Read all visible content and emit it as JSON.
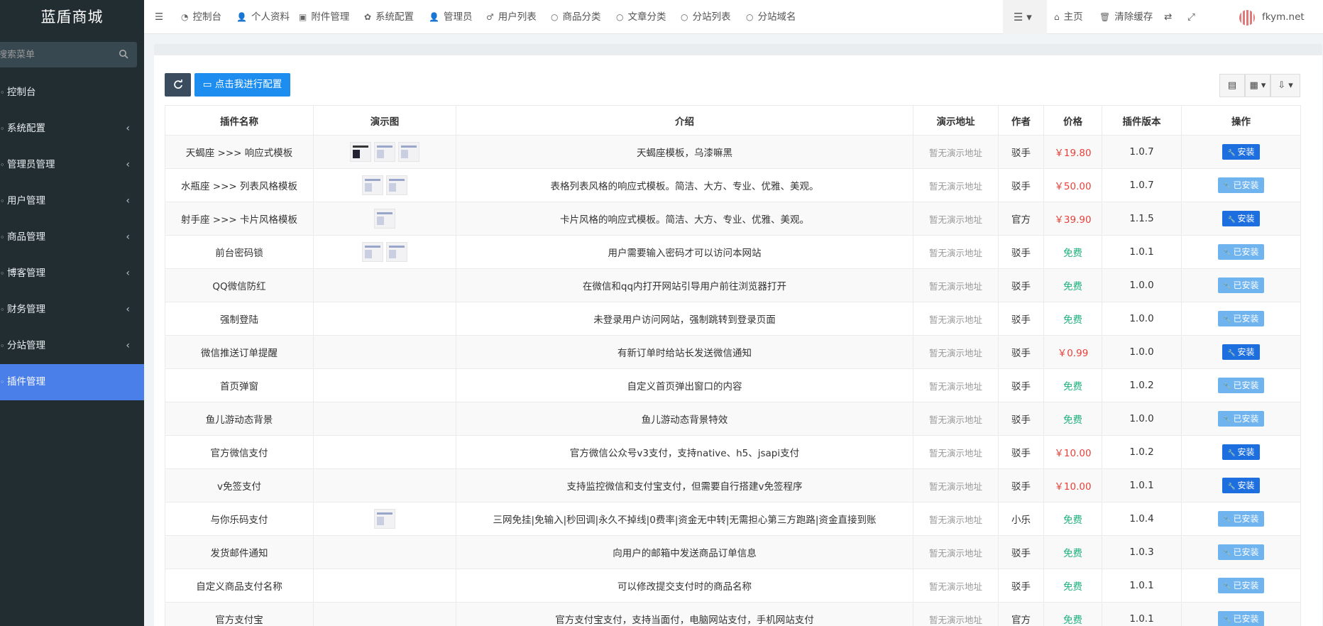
{
  "app": {
    "brand": "蓝盾商城",
    "search_placeholder": "搜索菜单"
  },
  "sidebar": {
    "items": [
      {
        "label": "控制台",
        "has_children": false,
        "active": false
      },
      {
        "label": "系统配置",
        "has_children": true,
        "active": false
      },
      {
        "label": "管理员管理",
        "has_children": true,
        "active": false
      },
      {
        "label": "用户管理",
        "has_children": true,
        "active": false
      },
      {
        "label": "商品管理",
        "has_children": true,
        "active": false
      },
      {
        "label": "博客管理",
        "has_children": true,
        "active": false
      },
      {
        "label": "财务管理",
        "has_children": true,
        "active": false
      },
      {
        "label": "分站管理",
        "has_children": true,
        "active": false
      },
      {
        "label": "插件管理",
        "has_children": false,
        "active": true
      }
    ]
  },
  "topnav": {
    "tabs": [
      {
        "label": "控制台",
        "icon": "dashboard-icon"
      },
      {
        "label": "个人资料",
        "icon": "user-icon"
      },
      {
        "label": "附件管理",
        "icon": "file-image-icon"
      },
      {
        "label": "系统配置",
        "icon": "gear-icon"
      },
      {
        "label": "管理员",
        "icon": "user-icon"
      },
      {
        "label": "用户列表",
        "icon": "male-icon"
      },
      {
        "label": "商品分类",
        "icon": "circle-icon"
      },
      {
        "label": "文章分类",
        "icon": "circle-icon"
      },
      {
        "label": "分站列表",
        "icon": "circle-icon"
      },
      {
        "label": "分站域名",
        "icon": "circle-icon"
      }
    ],
    "right": {
      "home": "主页",
      "clear_cache": "清除缓存",
      "site": "fkym.net"
    }
  },
  "toolbar": {
    "config_label": "点击我进行配置"
  },
  "table": {
    "headers": [
      "插件名称",
      "演示图",
      "介绍",
      "演示地址",
      "作者",
      "价格",
      "插件版本",
      "操作"
    ],
    "rows": [
      {
        "name": "天蝎座 >>> 响应式模板",
        "thumbs": 3,
        "intro": "天蝎座模板，乌漆嘛黑",
        "demo": "暂无演示地址",
        "author": "驳手",
        "price": "￥19.80",
        "paid": true,
        "version": "1.0.7",
        "action": "安装",
        "installed": false
      },
      {
        "name": "水瓶座 >>> 列表风格模板",
        "thumbs": 2,
        "intro": "表格列表风格的响应式模板。简洁、大方、专业、优雅、美观。",
        "demo": "暂无演示地址",
        "author": "驳手",
        "price": "￥50.00",
        "paid": true,
        "version": "1.0.7",
        "action": "已安装",
        "installed": true
      },
      {
        "name": "射手座 >>> 卡片风格模板",
        "thumbs": 1,
        "intro": "卡片风格的响应式模板。简洁、大方、专业、优雅、美观。",
        "demo": "暂无演示地址",
        "author": "官方",
        "price": "￥39.90",
        "paid": true,
        "version": "1.1.5",
        "action": "安装",
        "installed": false
      },
      {
        "name": "前台密码锁",
        "thumbs": 2,
        "intro": "用户需要输入密码才可以访问本网站",
        "demo": "暂无演示地址",
        "author": "驳手",
        "price": "免费",
        "paid": false,
        "version": "1.0.1",
        "action": "已安装",
        "installed": true
      },
      {
        "name": "QQ微信防红",
        "thumbs": 0,
        "intro": "在微信和qq内打开网站引导用户前往浏览器打开",
        "demo": "暂无演示地址",
        "author": "驳手",
        "price": "免费",
        "paid": false,
        "version": "1.0.0",
        "action": "已安装",
        "installed": true
      },
      {
        "name": "强制登陆",
        "thumbs": 0,
        "intro": "未登录用户访问网站，强制跳转到登录页面",
        "demo": "暂无演示地址",
        "author": "驳手",
        "price": "免费",
        "paid": false,
        "version": "1.0.0",
        "action": "已安装",
        "installed": true
      },
      {
        "name": "微信推送订单提醒",
        "thumbs": 0,
        "intro": "有新订单时给站长发送微信通知",
        "demo": "暂无演示地址",
        "author": "驳手",
        "price": "￥0.99",
        "paid": true,
        "version": "1.0.0",
        "action": "安装",
        "installed": false
      },
      {
        "name": "首页弹窗",
        "thumbs": 0,
        "intro": "自定义首页弹出窗口的内容",
        "demo": "暂无演示地址",
        "author": "驳手",
        "price": "免费",
        "paid": false,
        "version": "1.0.2",
        "action": "已安装",
        "installed": true
      },
      {
        "name": "鱼儿游动态背景",
        "thumbs": 0,
        "intro": "鱼儿游动态背景特效",
        "demo": "暂无演示地址",
        "author": "驳手",
        "price": "免费",
        "paid": false,
        "version": "1.0.0",
        "action": "已安装",
        "installed": true
      },
      {
        "name": "官方微信支付",
        "thumbs": 0,
        "intro": "官方微信公众号v3支付，支持native、h5、jsapi支付",
        "demo": "暂无演示地址",
        "author": "驳手",
        "price": "￥10.00",
        "paid": true,
        "version": "1.0.2",
        "action": "安装",
        "installed": false
      },
      {
        "name": "v免签支付",
        "thumbs": 0,
        "intro": "支持监控微信和支付宝支付，但需要自行搭建v免签程序",
        "demo": "暂无演示地址",
        "author": "驳手",
        "price": "￥10.00",
        "paid": true,
        "version": "1.0.1",
        "action": "安装",
        "installed": false
      },
      {
        "name": "与你乐码支付",
        "thumbs": 1,
        "intro": "三网免挂|免输入|秒回调|永久不掉线|0费率|资金无中转|无需担心第三方跑路|资金直接到账",
        "demo": "暂无演示地址",
        "author": "小乐",
        "price": "免费",
        "paid": false,
        "version": "1.0.4",
        "action": "已安装",
        "installed": true
      },
      {
        "name": "发货邮件通知",
        "thumbs": 0,
        "intro": "向用户的邮箱中发送商品订单信息",
        "demo": "暂无演示地址",
        "author": "驳手",
        "price": "免费",
        "paid": false,
        "version": "1.0.3",
        "action": "已安装",
        "installed": true
      },
      {
        "name": "自定义商品支付名称",
        "thumbs": 0,
        "intro": "可以修改提交支付时的商品名称",
        "demo": "暂无演示地址",
        "author": "驳手",
        "price": "免费",
        "paid": false,
        "version": "1.0.1",
        "action": "已安装",
        "installed": true
      },
      {
        "name": "官方支付宝",
        "thumbs": 0,
        "intro": "官方支付宝支付，支持当面付，电脑网站支付，手机网站支付",
        "demo": "暂无演示地址",
        "author": "官方",
        "price": "免费",
        "paid": false,
        "version": "1.0.1",
        "action": "已安装",
        "installed": true
      }
    ]
  },
  "colors": {
    "sidebar_bg": "#222d32",
    "sidebar_active": "#4a7ee8",
    "install_btn": "#1d6fe0",
    "installed_btn": "#6fb4ef",
    "price_paid": "#e8413a",
    "price_free": "#1cb07c"
  }
}
